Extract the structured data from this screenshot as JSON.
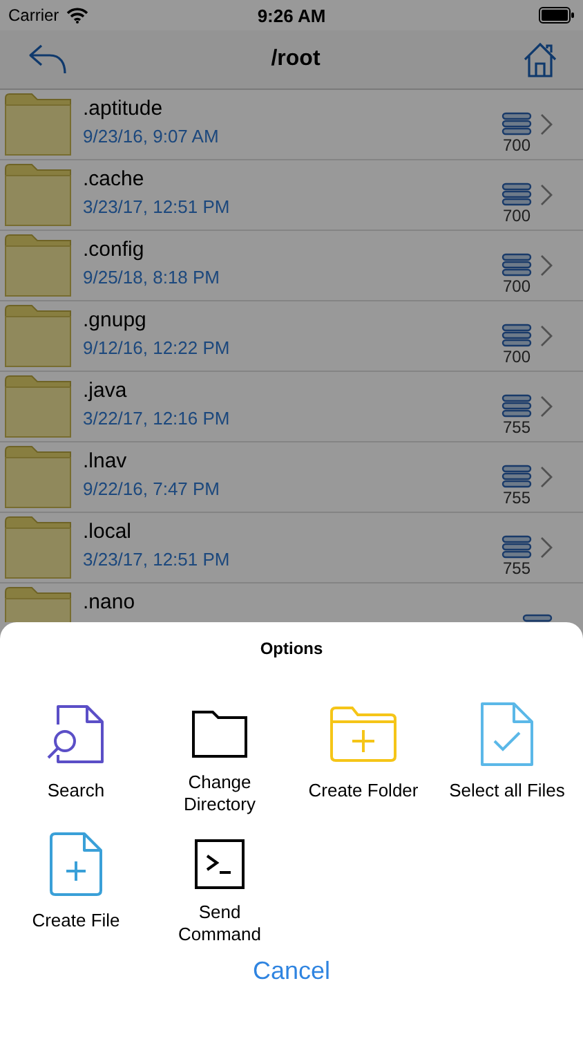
{
  "status_bar": {
    "carrier": "Carrier",
    "time": "9:26 AM"
  },
  "nav": {
    "title": "/root"
  },
  "files": [
    {
      "name": ".aptitude",
      "date": "9/23/16, 9:07 AM",
      "permissions": "700"
    },
    {
      "name": ".cache",
      "date": "3/23/17, 12:51 PM",
      "permissions": "700"
    },
    {
      "name": ".config",
      "date": "9/25/18, 8:18 PM",
      "permissions": "700"
    },
    {
      "name": ".gnupg",
      "date": "9/12/16, 12:22 PM",
      "permissions": "700"
    },
    {
      "name": ".java",
      "date": "3/22/17, 12:16 PM",
      "permissions": "755"
    },
    {
      "name": ".lnav",
      "date": "9/22/16, 7:47 PM",
      "permissions": "755"
    },
    {
      "name": ".local",
      "date": "3/23/17, 12:51 PM",
      "permissions": "755"
    },
    {
      "name": ".nano"
    }
  ],
  "sheet": {
    "title": "Options",
    "options": [
      {
        "kind": "search",
        "label": "Search"
      },
      {
        "kind": "folder",
        "label": "Change Directory"
      },
      {
        "kind": "folder-plus",
        "label": "Create Folder"
      },
      {
        "kind": "file-check",
        "label": "Select all Files"
      },
      {
        "kind": "file-plus",
        "label": "Create File"
      },
      {
        "kind": "terminal",
        "label": "Send Command"
      }
    ],
    "cancel": "Cancel"
  }
}
